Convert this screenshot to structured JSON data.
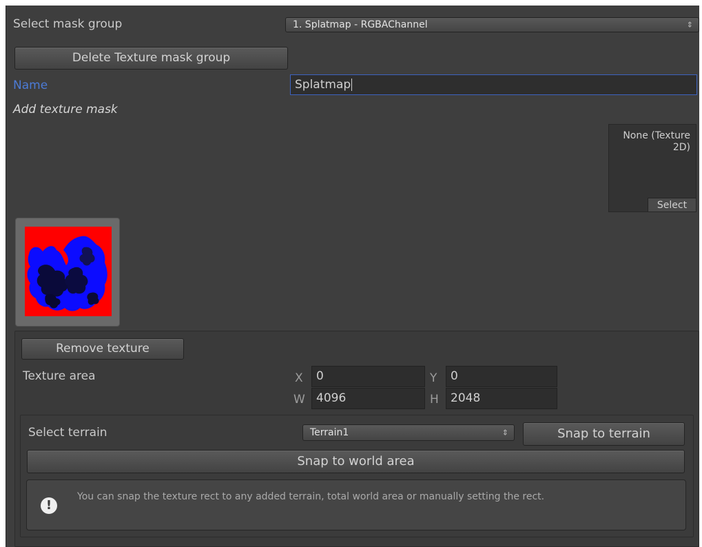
{
  "mask_group": {
    "label": "Select mask group",
    "selected": "1. Splatmap - RGBAChannel"
  },
  "delete_button": "Delete Texture mask group",
  "name_field": {
    "label": "Name",
    "value": "Splatmap"
  },
  "add_texture_label": "Add texture mask",
  "texture_slot": {
    "value": "None (Texture 2D)",
    "select_label": "Select"
  },
  "texture": {
    "remove_button": "Remove texture",
    "area_label": "Texture area",
    "x_label": "X",
    "x": "0",
    "y_label": "Y",
    "y": "0",
    "w_label": "W",
    "w": "4096",
    "h_label": "H",
    "h": "2048"
  },
  "terrain": {
    "label": "Select terrain",
    "selected": "Terrain1",
    "snap_terrain_button": "Snap to terrain",
    "snap_world_button": "Snap to world area"
  },
  "help": {
    "text": "You can snap the texture rect to any added terrain, total world area or manually setting the rect."
  },
  "colors": {
    "accent": "#4c7bd6",
    "panel": "#3e3e3e",
    "mask_red": "#ff0000",
    "mask_blue": "#0a0aff"
  }
}
